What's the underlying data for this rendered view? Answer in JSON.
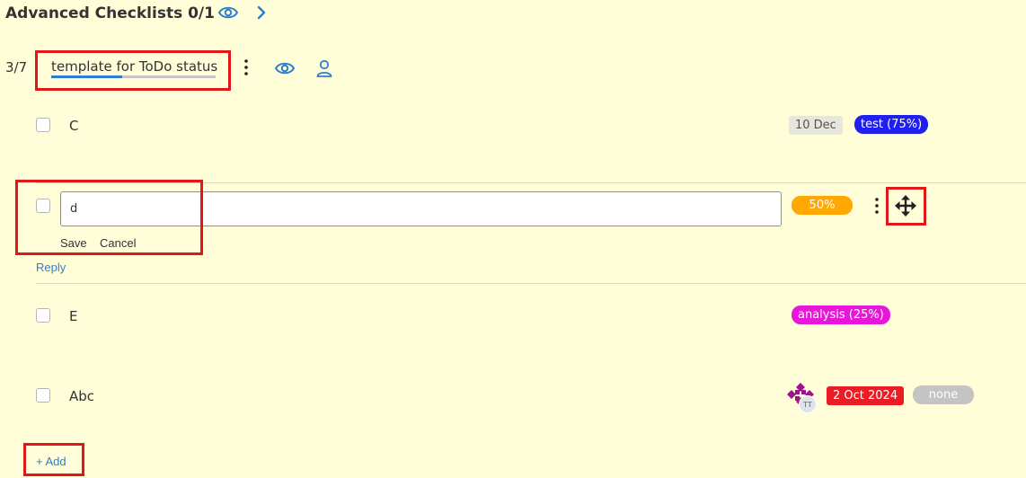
{
  "header": {
    "title": "Advanced Checklists 0/1",
    "icons": [
      "eye-icon",
      "chevron-right-icon"
    ]
  },
  "checklist": {
    "counter": "3/7",
    "name": "template for ToDo status",
    "progress_fraction": 0.43,
    "icons": [
      "kebab-menu-icon",
      "eye-icon",
      "user-icon"
    ]
  },
  "items": [
    {
      "label": "C",
      "date": "10 Dec",
      "status": "test (75%)",
      "status_color": "#1f1ff0"
    },
    {
      "input_value": "d",
      "save": "Save",
      "cancel": "Cancel",
      "progress": "50%",
      "progress_color": "#ffa800",
      "reply": "Reply"
    },
    {
      "label": "E",
      "status": "analysis (25%)",
      "status_color": "#e816d8"
    },
    {
      "label": "Abc",
      "avatar_initials": "TT",
      "date": "2 Oct 2024",
      "date_color": "#ec1c24",
      "status": "none",
      "status_color": "#c4c4c4"
    }
  ],
  "add_label": "+ Add",
  "colors": {
    "background": "#fffed9",
    "link": "#2f7fd0",
    "highlight_box": "#e01818"
  }
}
